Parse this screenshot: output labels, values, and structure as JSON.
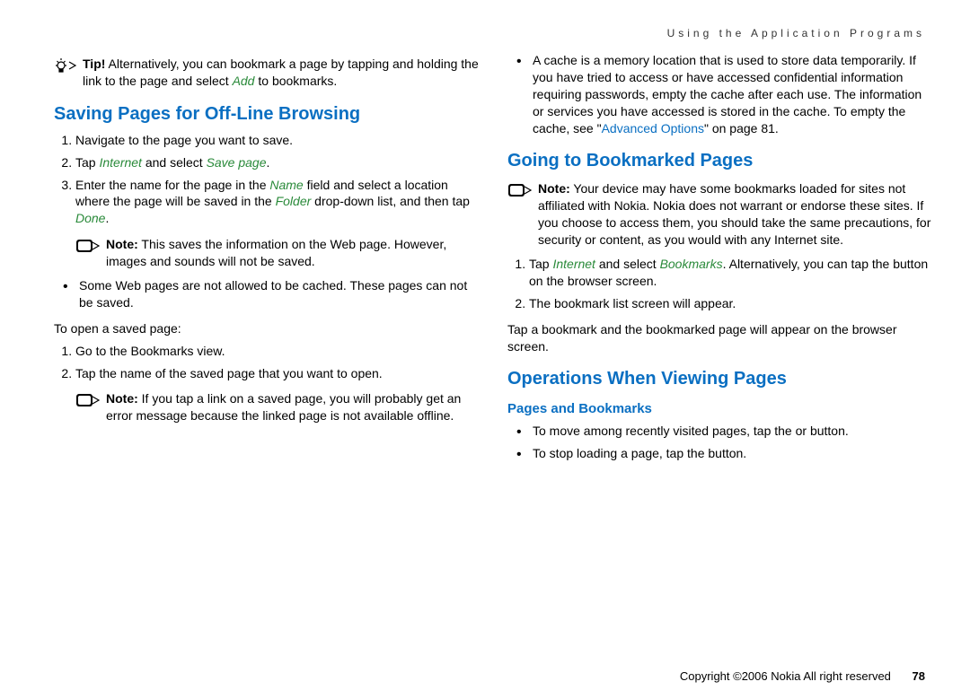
{
  "running_header": "Using the Application Programs",
  "left": {
    "tip": {
      "label": "Tip!",
      "body_a": " Alternatively, you can bookmark a page by tapping and holding the link to the page and select ",
      "green": "Add",
      "body_b": " to bookmarks."
    },
    "h2": "Saving Pages for Off-Line Browsing",
    "ol1": {
      "i1": "Navigate to the page you want to save.",
      "i2": {
        "a": "Tap ",
        "g1": "Internet",
        "b": " and select ",
        "g2": "Save page",
        "c": "."
      },
      "i3": {
        "a": "Enter the name for the page in the ",
        "g1": "Name",
        "b": " field and select a location where the page will be saved in the ",
        "g2": "Folder",
        "c": " drop-down list, and then tap ",
        "g3": "Done",
        "d": "."
      }
    },
    "note1": {
      "label": "Note:",
      "body": " This saves the information on the Web page. However, images and sounds will not be saved."
    },
    "bullet1": "Some Web pages are not allowed to be cached. These pages can not be saved.",
    "open_saved": "To open a saved page:",
    "ol2": {
      "i1": "Go to the Bookmarks view.",
      "i2": "Tap the name of the saved page that you want to open."
    },
    "note2": {
      "label": "Note:",
      "body": " If you tap a link on a saved page, you will probably get an error message because the linked page is not available offline."
    }
  },
  "right": {
    "cache_bullet": {
      "a": "A cache is a memory location that is used to store data temporarily. If you have tried to access or have accessed confidential information requiring passwords, empty the cache after each use. The information or services you have accessed is stored in the cache. To empty the cache, see \"",
      "link": "Advanced Options",
      "b": "\" on page 81."
    },
    "h2a": "Going to Bookmarked Pages",
    "note": {
      "label": "Note:",
      "body": " Your device may have some bookmarks loaded for sites not affiliated with Nokia. Nokia does not warrant or endorse these sites. If you choose to access them, you should take the same precautions, for security or content, as you would with any Internet site."
    },
    "ol": {
      "i1": {
        "a": "Tap ",
        "g1": "Internet",
        "b": " and select ",
        "g2": "Bookmarks",
        "c": ". Alternatively, you can tap the        button on the browser screen."
      },
      "i2": "The bookmark list screen will appear."
    },
    "para": "Tap a bookmark and the bookmarked page will appear on the browser screen.",
    "h2b": "Operations When Viewing Pages",
    "h3": "Pages and Bookmarks",
    "ul": {
      "i1": "To move among recently visited pages, tap the        or        button.",
      "i2": "To stop loading a page, tap the        button."
    }
  },
  "footer": {
    "copyright": "Copyright ©2006 Nokia All right reserved",
    "page": "78"
  }
}
